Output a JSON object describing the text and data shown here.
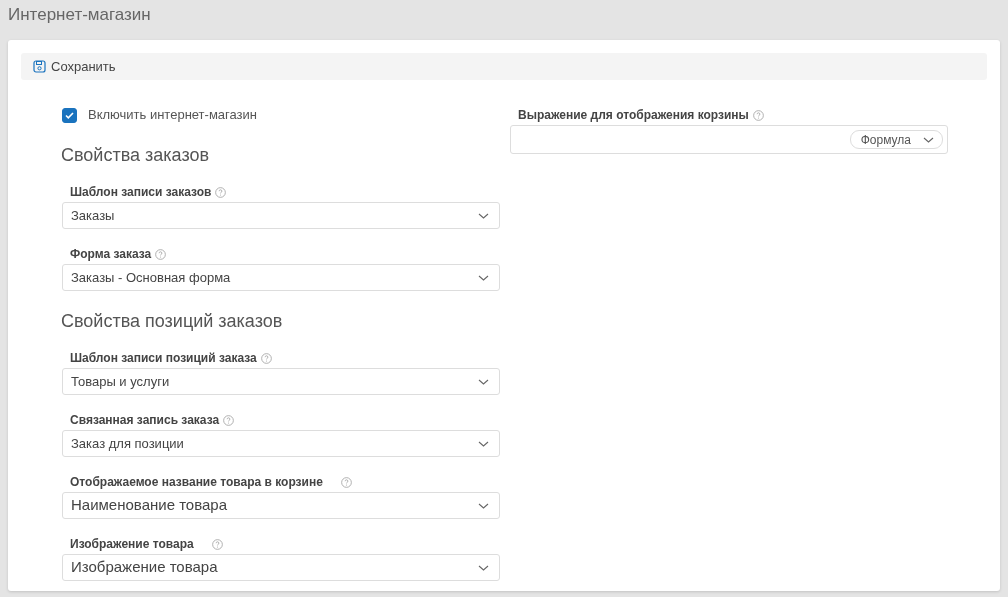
{
  "page": {
    "title": "Интернет-магазин"
  },
  "toolbar": {
    "save_label": "Сохранить"
  },
  "left": [
    {
      "kind": "checkbox",
      "label": "Включить интернет-магазин",
      "checked": true
    },
    {
      "kind": "heading",
      "text": "Свойства заказов"
    },
    {
      "kind": "select",
      "label": "Шаблон записи заказов",
      "value": "Заказы"
    },
    {
      "kind": "select",
      "label": "Форма заказа",
      "value": "Заказы - Основная форма"
    },
    {
      "kind": "heading",
      "text": "Свойства позиций заказов"
    },
    {
      "kind": "select",
      "label": "Шаблон записи позиций заказа",
      "value": "Товары и услуги"
    },
    {
      "kind": "select",
      "label": "Связанная запись заказа",
      "value": "Заказ для позиции"
    },
    {
      "kind": "select-large",
      "label": "Отображаемое название товара в корзине",
      "value": "Наименование товара"
    },
    {
      "kind": "select-large",
      "label": "Изображение товара",
      "value": "Изображение товара"
    }
  ],
  "right": {
    "label": "Выражение для отображения корзины",
    "mode_button": "Формула"
  }
}
